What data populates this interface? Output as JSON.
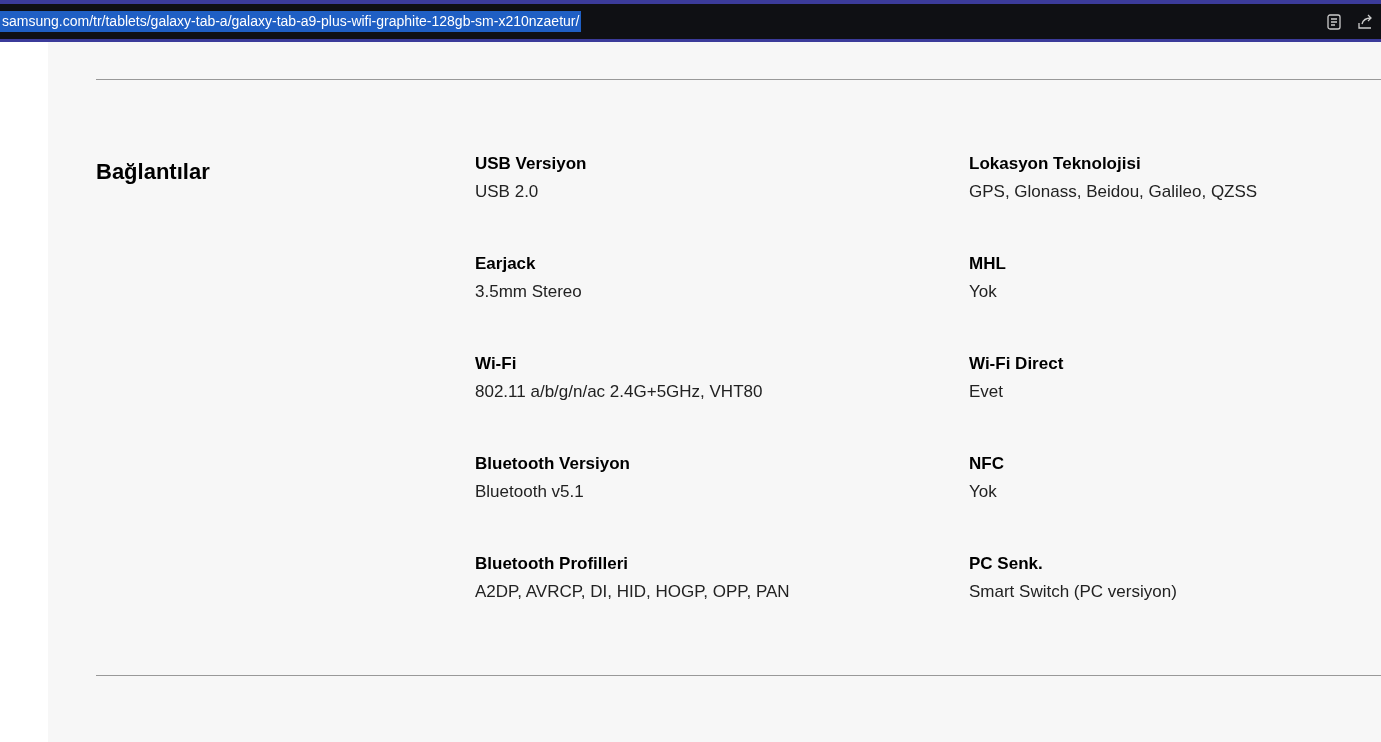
{
  "address_bar": {
    "url": "samsung.com/tr/tablets/galaxy-tab-a/galaxy-tab-a9-plus-wifi-graphite-128gb-sm-x210nzaetur/",
    "selected": true
  },
  "section": {
    "title": "Bağlantılar",
    "specs": [
      {
        "label": "USB Versiyon",
        "value": "USB 2.0"
      },
      {
        "label": "Lokasyon Teknolojisi",
        "value": "GPS, Glonass, Beidou, Galileo, QZSS"
      },
      {
        "label": "Earjack",
        "value": "3.5mm Stereo"
      },
      {
        "label": "MHL",
        "value": "Yok"
      },
      {
        "label": "Wi-Fi",
        "value": "802.11 a/b/g/n/ac 2.4G+5GHz, VHT80"
      },
      {
        "label": "Wi-Fi Direct",
        "value": "Evet"
      },
      {
        "label": "Bluetooth Versiyon",
        "value": "Bluetooth v5.1"
      },
      {
        "label": "NFC",
        "value": "Yok"
      },
      {
        "label": "Bluetooth Profilleri",
        "value": "A2DP, AVRCP, DI, HID, HOGP, OPP, PAN"
      },
      {
        "label": "PC Senk.",
        "value": "Smart Switch (PC versiyon)"
      }
    ]
  }
}
